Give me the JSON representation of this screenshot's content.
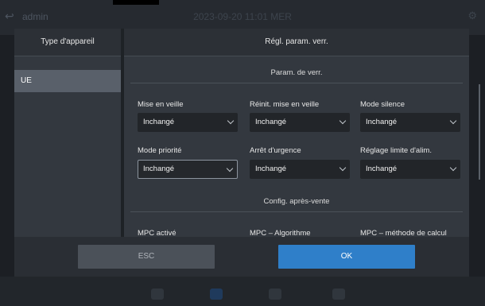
{
  "topbar": {
    "user": "admin",
    "datetime": "2023-09-20 11:01 MER"
  },
  "dialog": {
    "left_header": "Type d'appareil",
    "left_items": [
      "UE"
    ],
    "right_header": "Régl. param. verr.",
    "section1_title": "Param. de verr.",
    "section2_title": "Config. après-vente",
    "fields": [
      {
        "label": "Mise en veille",
        "value": "Inchangé"
      },
      {
        "label": "Réinit. mise en veille",
        "value": "Inchangé"
      },
      {
        "label": "Mode silence",
        "value": "Inchangé"
      },
      {
        "label": "Mode priorité",
        "value": "Inchangé"
      },
      {
        "label": "Arrêt d'urgence",
        "value": "Inchangé"
      },
      {
        "label": "Réglage limite d'alim.",
        "value": "Inchangé"
      }
    ],
    "after_sales_fields": [
      {
        "label": "MPC activé"
      },
      {
        "label": "MPC – Algorithme"
      },
      {
        "label": "MPC – méthode de calcul"
      }
    ],
    "buttons": {
      "esc": "ESC",
      "ok": "OK"
    }
  },
  "colors": {
    "accent": "#2f7fc9",
    "selected_item": "#59606a"
  }
}
